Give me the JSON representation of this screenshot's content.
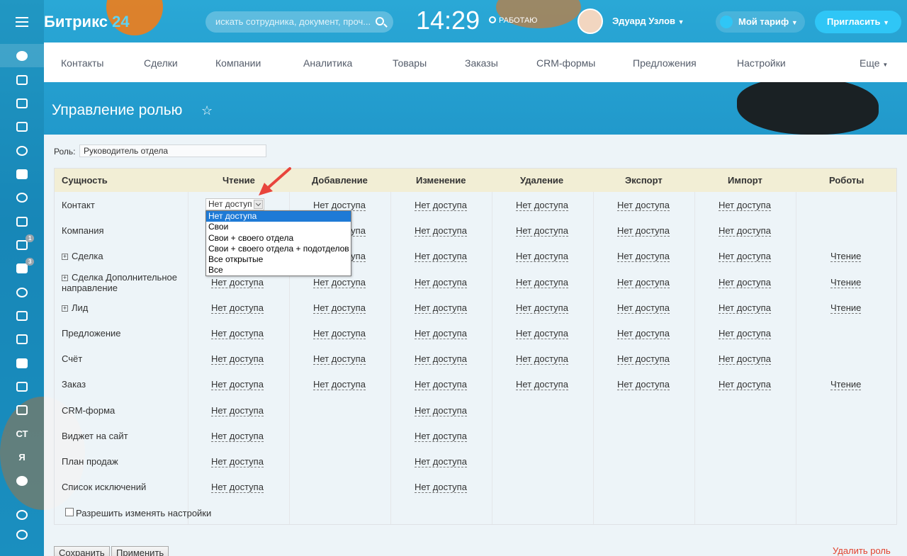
{
  "header": {
    "logo_text": "Битрикс",
    "logo_num": "24",
    "search_placeholder": "искать сотрудника, документ, проч...",
    "clock": "14:29",
    "work_status": "РАБОТАЮ",
    "user_name": "Эдуард Узлов",
    "tariff": "Мой тариф",
    "invite": "Пригласить"
  },
  "sidebar": {
    "badges": [
      "1",
      "3"
    ],
    "text_items": [
      "СТ",
      "Я"
    ]
  },
  "topnav": {
    "items": [
      "Контакты",
      "Сделки",
      "Компании",
      "Аналитика",
      "Товары",
      "Заказы",
      "CRM-формы",
      "Предложения",
      "Настройки"
    ],
    "more": "Еще"
  },
  "page": {
    "title": "Управление ролью",
    "role_label": "Роль:",
    "role_value": "Руководитель отдела"
  },
  "table": {
    "headers": [
      "Сущность",
      "Чтение",
      "Добавление",
      "Изменение",
      "Удаление",
      "Экспорт",
      "Импорт",
      "Роботы"
    ],
    "rows": [
      {
        "name": "Контакт",
        "expand": false,
        "cells": [
          "Нет доступа",
          "Нет доступа",
          "Нет доступа",
          "Нет доступа",
          "Нет доступа",
          "Нет доступа",
          ""
        ]
      },
      {
        "name": "Компания",
        "expand": false,
        "cells": [
          "Нет доступа",
          "Нет доступа",
          "Нет доступа",
          "Нет доступа",
          "Нет доступа",
          "Нет доступа",
          ""
        ]
      },
      {
        "name": "Сделка",
        "expand": true,
        "cells": [
          "Нет доступа",
          "Нет доступа",
          "Нет доступа",
          "Нет доступа",
          "Нет доступа",
          "Нет доступа",
          "Чтение"
        ]
      },
      {
        "name": "Сделка Дополнительное",
        "name2": "направление",
        "expand": true,
        "cells": [
          "Нет доступа",
          "Нет доступа",
          "Нет доступа",
          "Нет доступа",
          "Нет доступа",
          "Нет доступа",
          "Чтение"
        ]
      },
      {
        "name": "Лид",
        "expand": true,
        "cells": [
          "Нет доступа",
          "Нет доступа",
          "Нет доступа",
          "Нет доступа",
          "Нет доступа",
          "Нет доступа",
          "Чтение"
        ]
      },
      {
        "name": "Предложение",
        "expand": false,
        "cells": [
          "Нет доступа",
          "Нет доступа",
          "Нет доступа",
          "Нет доступа",
          "Нет доступа",
          "Нет доступа",
          ""
        ]
      },
      {
        "name": "Счёт",
        "expand": false,
        "cells": [
          "Нет доступа",
          "Нет доступа",
          "Нет доступа",
          "Нет доступа",
          "Нет доступа",
          "Нет доступа",
          ""
        ]
      },
      {
        "name": "Заказ",
        "expand": false,
        "cells": [
          "Нет доступа",
          "Нет доступа",
          "Нет доступа",
          "Нет доступа",
          "Нет доступа",
          "Нет доступа",
          "Чтение"
        ]
      },
      {
        "name": "CRM-форма",
        "expand": false,
        "cells": [
          "Нет доступа",
          "",
          "Нет доступа",
          "",
          "",
          "",
          ""
        ]
      },
      {
        "name": "Виджет на сайт",
        "expand": false,
        "cells": [
          "Нет доступа",
          "",
          "Нет доступа",
          "",
          "",
          "",
          ""
        ]
      },
      {
        "name": "План продаж",
        "expand": false,
        "cells": [
          "Нет доступа",
          "",
          "Нет доступа",
          "",
          "",
          "",
          ""
        ]
      },
      {
        "name": "Список исключений",
        "expand": false,
        "cells": [
          "Нет доступа",
          "",
          "Нет доступа",
          "",
          "",
          "",
          ""
        ]
      }
    ],
    "open_select": {
      "value": "Нет доступ",
      "options": [
        "Нет доступа",
        "Свои",
        "Свои + своего отдела",
        "Свои + своего отдела + подотделов",
        "Все открытые",
        "Все"
      ],
      "selected_index": 0
    }
  },
  "footer": {
    "allow_label": "Разрешить изменять настройки",
    "save": "Сохранить",
    "apply": "Применить",
    "delete": "Удалить роль"
  },
  "colors": {
    "accent": "#2fc6f6",
    "selected_option": "#1e7ad6",
    "delete_link": "#e1412d",
    "table_header": "#f2eed5"
  }
}
